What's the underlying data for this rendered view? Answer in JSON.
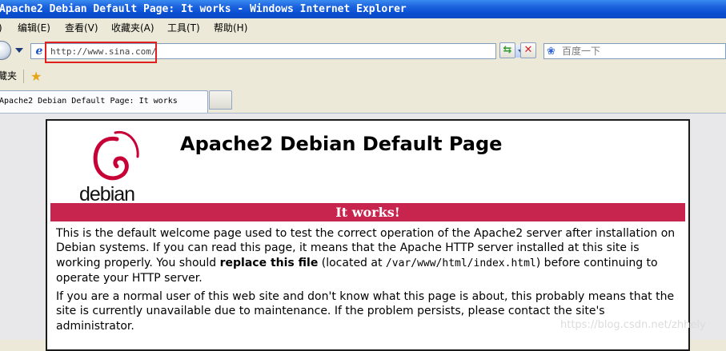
{
  "window": {
    "title": "Apache2 Debian Default Page: It works - Windows Internet Explorer"
  },
  "menu": {
    "items": [
      {
        "label": "编辑(E)"
      },
      {
        "label": "查看(V)"
      },
      {
        "label": "收藏夹(A)"
      },
      {
        "label": "工具(T)"
      },
      {
        "label": "帮助(H)"
      }
    ],
    "partial_left": ")"
  },
  "address_bar": {
    "url": "http://www.sina.com/",
    "search_placeholder": "百度一下"
  },
  "favorites_bar": {
    "label": "藏夹"
  },
  "tabs": [
    {
      "label": "Apache2 Debian Default Page: It works",
      "active": true
    }
  ],
  "page": {
    "logo_text": "debian",
    "title": "Apache2 Debian Default Page",
    "banner": "It works!",
    "p1_a": "This is the default welcome page used to test the correct operation of the Apache2 server after installation on Debian systems. If you can read this page, it means that the Apache HTTP server installed at this site is working properly. You should ",
    "p1_bold": "replace this file",
    "p1_b": " (located at ",
    "p1_code": "/var/www/html/index.html",
    "p1_c": ") before continuing to operate your HTTP server.",
    "p2": "If you are a normal user of this web site and don't know what this page is about, this probably means that the site is currently unavailable due to maintenance. If the problem persists, please contact the site's administrator."
  },
  "watermark": "https://blog.csdn.net/zhhely",
  "colors": {
    "banner": "#c7254e",
    "debian_red": "#c70036",
    "title_bar": "#0a4fd2",
    "url_highlight": "#e02020"
  }
}
